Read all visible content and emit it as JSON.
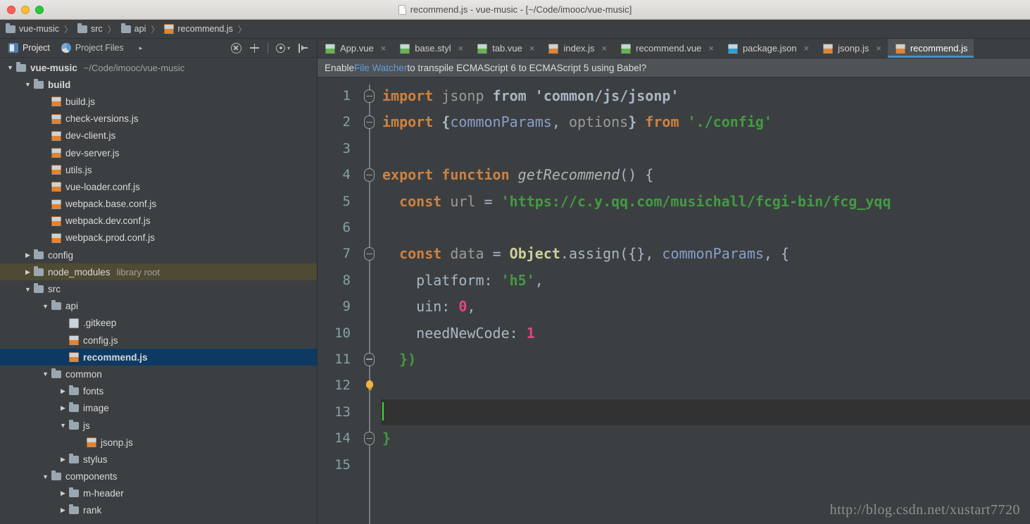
{
  "window": {
    "title": "recommend.js - vue-music - [~/Code/imooc/vue-music]",
    "traffic_lights": [
      "close",
      "minimize",
      "maximize"
    ]
  },
  "breadcrumb": {
    "separator": "〉",
    "items": [
      {
        "label": "vue-music",
        "icon": "folder-icon"
      },
      {
        "label": "src",
        "icon": "folder-icon"
      },
      {
        "label": "api",
        "icon": "folder-icon"
      },
      {
        "label": "recommend.js",
        "icon": "js-file-icon"
      }
    ]
  },
  "project_panel": {
    "tabs": [
      {
        "label": "Project",
        "icon": "project-icon",
        "selected": true
      },
      {
        "label": "Project Files",
        "icon": "project-files-icon",
        "selected": false
      }
    ],
    "more_arrow": "▸",
    "tools": [
      {
        "name": "collapse-all-icon",
        "title": "Collapse All"
      },
      {
        "name": "locate-icon",
        "title": "Select Opened File"
      },
      {
        "name": "divider",
        "title": ""
      },
      {
        "name": "settings-gear-icon",
        "title": "Settings"
      },
      {
        "name": "hide-panel-icon",
        "title": "Hide"
      }
    ],
    "tree": [
      {
        "label": "vue-music",
        "note": "~/Code/imooc/vue-music",
        "indent": 0,
        "twisty": "▼",
        "icon": "folder-icon",
        "bold": true,
        "state": "normal"
      },
      {
        "label": "build",
        "note": "",
        "indent": 1,
        "twisty": "▼",
        "icon": "folder-icon",
        "bold": true,
        "state": "normal"
      },
      {
        "label": "build.js",
        "note": "",
        "indent": 2,
        "twisty": "",
        "icon": "js-file-icon",
        "bold": false,
        "state": "normal"
      },
      {
        "label": "check-versions.js",
        "note": "",
        "indent": 2,
        "twisty": "",
        "icon": "js-file-icon",
        "bold": false,
        "state": "normal"
      },
      {
        "label": "dev-client.js",
        "note": "",
        "indent": 2,
        "twisty": "",
        "icon": "js-file-icon",
        "bold": false,
        "state": "normal"
      },
      {
        "label": "dev-server.js",
        "note": "",
        "indent": 2,
        "twisty": "",
        "icon": "js-file-icon",
        "bold": false,
        "state": "normal"
      },
      {
        "label": "utils.js",
        "note": "",
        "indent": 2,
        "twisty": "",
        "icon": "js-file-icon",
        "bold": false,
        "state": "normal"
      },
      {
        "label": "vue-loader.conf.js",
        "note": "",
        "indent": 2,
        "twisty": "",
        "icon": "js-file-icon",
        "bold": false,
        "state": "normal"
      },
      {
        "label": "webpack.base.conf.js",
        "note": "",
        "indent": 2,
        "twisty": "",
        "icon": "js-file-icon",
        "bold": false,
        "state": "normal"
      },
      {
        "label": "webpack.dev.conf.js",
        "note": "",
        "indent": 2,
        "twisty": "",
        "icon": "js-file-icon",
        "bold": false,
        "state": "normal"
      },
      {
        "label": "webpack.prod.conf.js",
        "note": "",
        "indent": 2,
        "twisty": "",
        "icon": "js-file-icon",
        "bold": false,
        "state": "normal"
      },
      {
        "label": "config",
        "note": "",
        "indent": 1,
        "twisty": "▶",
        "icon": "folder-icon",
        "bold": false,
        "state": "normal"
      },
      {
        "label": "node_modules",
        "note": "library root",
        "indent": 1,
        "twisty": "▶",
        "icon": "folder-icon",
        "bold": false,
        "state": "library-root"
      },
      {
        "label": "src",
        "note": "",
        "indent": 1,
        "twisty": "▼",
        "icon": "folder-icon",
        "bold": false,
        "state": "normal"
      },
      {
        "label": "api",
        "note": "",
        "indent": 2,
        "twisty": "▼",
        "icon": "folder-icon",
        "bold": false,
        "state": "normal"
      },
      {
        "label": ".gitkeep",
        "note": "",
        "indent": 3,
        "twisty": "",
        "icon": "plain-file-icon",
        "bold": false,
        "state": "normal"
      },
      {
        "label": "config.js",
        "note": "",
        "indent": 3,
        "twisty": "",
        "icon": "js-file-icon",
        "bold": false,
        "state": "normal"
      },
      {
        "label": "recommend.js",
        "note": "",
        "indent": 3,
        "twisty": "",
        "icon": "js-file-icon",
        "bold": true,
        "state": "selected"
      },
      {
        "label": "common",
        "note": "",
        "indent": 2,
        "twisty": "▼",
        "icon": "folder-icon",
        "bold": false,
        "state": "normal"
      },
      {
        "label": "fonts",
        "note": "",
        "indent": 3,
        "twisty": "▶",
        "icon": "folder-icon",
        "bold": false,
        "state": "normal"
      },
      {
        "label": "image",
        "note": "",
        "indent": 3,
        "twisty": "▶",
        "icon": "folder-icon",
        "bold": false,
        "state": "normal"
      },
      {
        "label": "js",
        "note": "",
        "indent": 3,
        "twisty": "▼",
        "icon": "folder-icon",
        "bold": false,
        "state": "normal"
      },
      {
        "label": "jsonp.js",
        "note": "",
        "indent": 4,
        "twisty": "",
        "icon": "js-file-icon",
        "bold": false,
        "state": "normal"
      },
      {
        "label": "stylus",
        "note": "",
        "indent": 3,
        "twisty": "▶",
        "icon": "folder-icon",
        "bold": false,
        "state": "normal"
      },
      {
        "label": "components",
        "note": "",
        "indent": 2,
        "twisty": "▼",
        "icon": "folder-icon",
        "bold": false,
        "state": "normal"
      },
      {
        "label": "m-header",
        "note": "",
        "indent": 3,
        "twisty": "▶",
        "icon": "folder-icon",
        "bold": false,
        "state": "normal"
      },
      {
        "label": "rank",
        "note": "",
        "indent": 3,
        "twisty": "▶",
        "icon": "folder-icon",
        "bold": false,
        "state": "normal"
      }
    ]
  },
  "editor": {
    "tabs": [
      {
        "label": "App.vue",
        "icon": "vue-file-icon",
        "active": false,
        "close": "×"
      },
      {
        "label": "base.styl",
        "icon": "vue-file-icon",
        "active": false,
        "close": "×"
      },
      {
        "label": "tab.vue",
        "icon": "vue-file-icon",
        "active": false,
        "close": "×"
      },
      {
        "label": "index.js",
        "icon": "js-file-icon",
        "active": false,
        "close": "×"
      },
      {
        "label": "recommend.vue",
        "icon": "vue-file-icon",
        "active": false,
        "close": "×"
      },
      {
        "label": "package.json",
        "icon": "json-file-icon",
        "active": false,
        "close": "×"
      },
      {
        "label": "jsonp.js",
        "icon": "js-file-icon",
        "active": false,
        "close": "×"
      },
      {
        "label": "recommend.js",
        "icon": "js-file-icon",
        "active": true,
        "close": ""
      }
    ],
    "notification": {
      "prefix": "Enable ",
      "link": "File Watcher",
      "suffix": " to transpile ECMAScript 6 to ECMAScript 5 using Babel?"
    },
    "line_numbers": [
      "1",
      "2",
      "3",
      "4",
      "5",
      "6",
      "7",
      "8",
      "9",
      "10",
      "11",
      "12",
      "13",
      "14",
      "15"
    ],
    "current_line": 13,
    "cursor_line_index": 12,
    "bulb_line_index": 11,
    "fold_lines": [
      0,
      1,
      3,
      6,
      10,
      13
    ],
    "code_lines": [
      {
        "n": 1,
        "tokens": [
          {
            "t": "import",
            "c": "kw"
          },
          {
            "t": " ",
            "c": "plain"
          },
          {
            "t": "jsonp",
            "c": "dim"
          },
          {
            "t": " ",
            "c": "plain"
          },
          {
            "t": "from",
            "c": "def"
          },
          {
            "t": " ",
            "c": "plain"
          },
          {
            "t": "'common/js/jsonp'",
            "c": "def"
          }
        ]
      },
      {
        "n": 2,
        "tokens": [
          {
            "t": "import",
            "c": "kw"
          },
          {
            "t": " ",
            "c": "plain"
          },
          {
            "t": "{",
            "c": "brc"
          },
          {
            "t": "commonParams",
            "c": "imp"
          },
          {
            "t": ", ",
            "c": "plain"
          },
          {
            "t": "options",
            "c": "dim"
          },
          {
            "t": "}",
            "c": "brc"
          },
          {
            "t": " ",
            "c": "plain"
          },
          {
            "t": "from",
            "c": "kw"
          },
          {
            "t": " ",
            "c": "plain"
          },
          {
            "t": "'./config'",
            "c": "str"
          }
        ]
      },
      {
        "n": 3,
        "tokens": []
      },
      {
        "n": 4,
        "tokens": [
          {
            "t": "export",
            "c": "kw"
          },
          {
            "t": " ",
            "c": "plain"
          },
          {
            "t": "function",
            "c": "kw"
          },
          {
            "t": " ",
            "c": "plain"
          },
          {
            "t": "getRecommend",
            "c": "fn"
          },
          {
            "t": "() {",
            "c": "plain"
          }
        ]
      },
      {
        "n": 5,
        "tokens": [
          {
            "t": "  ",
            "c": "plain"
          },
          {
            "t": "const",
            "c": "kw"
          },
          {
            "t": " ",
            "c": "plain"
          },
          {
            "t": "url",
            "c": "dim"
          },
          {
            "t": " = ",
            "c": "plain"
          },
          {
            "t": "'https://c.y.qq.com/musichall/fcgi-bin/fcg_yqq",
            "c": "str"
          }
        ]
      },
      {
        "n": 6,
        "tokens": []
      },
      {
        "n": 7,
        "tokens": [
          {
            "t": "  ",
            "c": "plain"
          },
          {
            "t": "const",
            "c": "kw"
          },
          {
            "t": " ",
            "c": "plain"
          },
          {
            "t": "data",
            "c": "dim"
          },
          {
            "t": " = ",
            "c": "plain"
          },
          {
            "t": "Object",
            "c": "obj"
          },
          {
            "t": ".",
            "c": "plain"
          },
          {
            "t": "assign",
            "c": "plain"
          },
          {
            "t": "({}, ",
            "c": "plain"
          },
          {
            "t": "commonParams",
            "c": "imp"
          },
          {
            "t": ", {",
            "c": "plain"
          }
        ]
      },
      {
        "n": 8,
        "tokens": [
          {
            "t": "    ",
            "c": "plain"
          },
          {
            "t": "platform",
            "c": "plain"
          },
          {
            "t": ": ",
            "c": "plain"
          },
          {
            "t": "'h5'",
            "c": "str"
          },
          {
            "t": ",",
            "c": "plain"
          }
        ]
      },
      {
        "n": 9,
        "tokens": [
          {
            "t": "    ",
            "c": "plain"
          },
          {
            "t": "uin",
            "c": "plain"
          },
          {
            "t": ": ",
            "c": "plain"
          },
          {
            "t": "0",
            "c": "num"
          },
          {
            "t": ",",
            "c": "plain"
          }
        ]
      },
      {
        "n": 10,
        "tokens": [
          {
            "t": "    ",
            "c": "plain"
          },
          {
            "t": "needNewCode",
            "c": "plain"
          },
          {
            "t": ": ",
            "c": "plain"
          },
          {
            "t": "1",
            "c": "num"
          }
        ]
      },
      {
        "n": 11,
        "tokens": [
          {
            "t": "  ",
            "c": "plain"
          },
          {
            "t": "})",
            "c": "str"
          }
        ]
      },
      {
        "n": 12,
        "tokens": []
      },
      {
        "n": 13,
        "tokens": []
      },
      {
        "n": 14,
        "tokens": [
          {
            "t": "}",
            "c": "str"
          }
        ]
      },
      {
        "n": 15,
        "tokens": []
      }
    ]
  },
  "watermark": "http://blog.csdn.net/xustart7720",
  "colors": {
    "panel_bg": "#3c3f41",
    "selection_blue": "#0d3a63",
    "library_root": "#4e4a33",
    "active_tab_underline": "#4a90c4",
    "keyword": "#cc8242",
    "string": "#429b42",
    "number": "#e8437f",
    "identifier": "#88a0c8",
    "line_number": "#83a2ab",
    "caret": "#3ddc3d",
    "link": "#619ede"
  }
}
